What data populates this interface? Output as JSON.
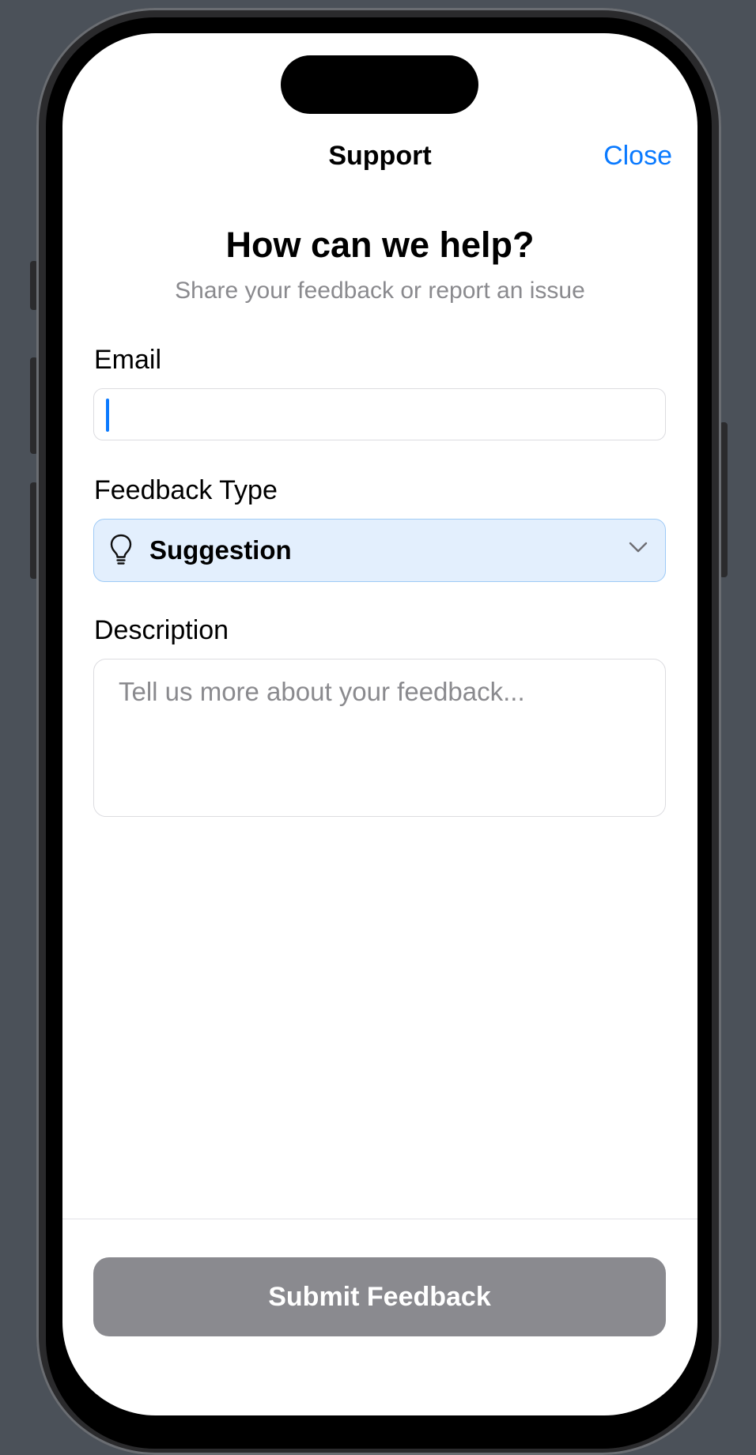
{
  "nav": {
    "title": "Support",
    "close_label": "Close"
  },
  "header": {
    "heading": "How can we help?",
    "subheading": "Share your feedback or report an issue"
  },
  "form": {
    "email": {
      "label": "Email",
      "value": ""
    },
    "feedback_type": {
      "label": "Feedback Type",
      "icon": "lightbulb-icon",
      "selected": "Suggestion"
    },
    "description": {
      "label": "Description",
      "placeholder": "Tell us more about your feedback..."
    },
    "submit_label": "Submit Feedback"
  },
  "colors": {
    "accent": "#0a7aff",
    "select_bg": "#e3effd",
    "select_border": "#9ecaf6",
    "submit_disabled": "#8a8a8f"
  }
}
